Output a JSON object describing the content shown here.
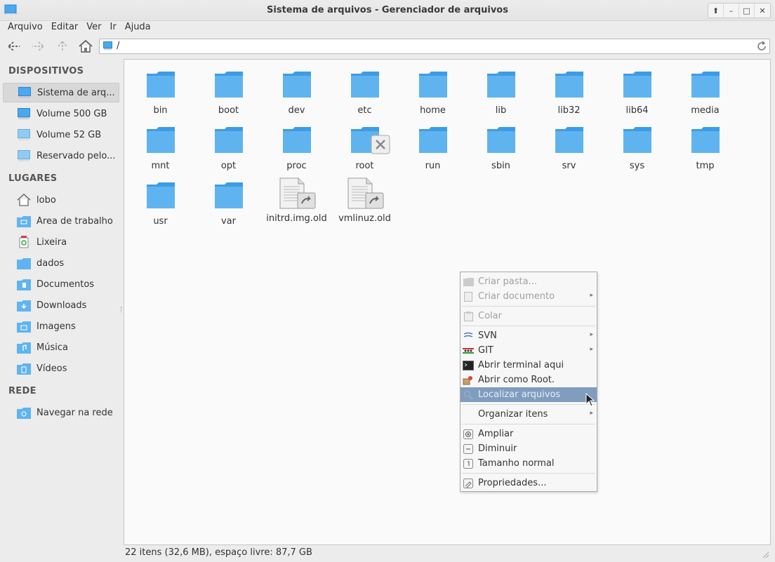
{
  "window": {
    "title": "Sistema de arquivos - Gerenciador de arquivos"
  },
  "menubar": [
    "Arquivo",
    "Editar",
    "Ver",
    "Ir",
    "Ajuda"
  ],
  "address": {
    "path": "/"
  },
  "sidebar": {
    "devices_header": "DISPOSITIVOS",
    "devices": [
      {
        "label": "Sistema de arq...",
        "icon": "drive-icon",
        "selected": true
      },
      {
        "label": "Volume 500 GB",
        "icon": "drive-icon",
        "selected": false
      },
      {
        "label": "Volume 52 GB",
        "icon": "drive-icon",
        "selected": false
      },
      {
        "label": "Reservado pelo...",
        "icon": "drive-icon",
        "selected": false
      }
    ],
    "places_header": "LUGARES",
    "places": [
      {
        "label": "lobo",
        "icon": "home-icon"
      },
      {
        "label": "Área de trabalho",
        "icon": "desktop-folder-icon"
      },
      {
        "label": "Lixeira",
        "icon": "trash-icon"
      },
      {
        "label": "dados",
        "icon": "folder-icon"
      },
      {
        "label": "Documentos",
        "icon": "documents-folder-icon"
      },
      {
        "label": "Downloads",
        "icon": "downloads-folder-icon"
      },
      {
        "label": "Imagens",
        "icon": "pictures-folder-icon"
      },
      {
        "label": "Música",
        "icon": "music-folder-icon"
      },
      {
        "label": "Vídeos",
        "icon": "videos-folder-icon"
      }
    ],
    "network_header": "REDE",
    "network": [
      {
        "label": "Navegar na rede",
        "icon": "network-folder-icon"
      }
    ]
  },
  "files": [
    {
      "name": "bin",
      "type": "folder"
    },
    {
      "name": "boot",
      "type": "folder"
    },
    {
      "name": "dev",
      "type": "folder"
    },
    {
      "name": "etc",
      "type": "folder"
    },
    {
      "name": "home",
      "type": "folder"
    },
    {
      "name": "lib",
      "type": "folder"
    },
    {
      "name": "lib32",
      "type": "folder"
    },
    {
      "name": "lib64",
      "type": "folder"
    },
    {
      "name": "media",
      "type": "folder"
    },
    {
      "name": "mnt",
      "type": "folder"
    },
    {
      "name": "opt",
      "type": "folder"
    },
    {
      "name": "proc",
      "type": "folder"
    },
    {
      "name": "root",
      "type": "folder-locked"
    },
    {
      "name": "run",
      "type": "folder"
    },
    {
      "name": "sbin",
      "type": "folder"
    },
    {
      "name": "srv",
      "type": "folder"
    },
    {
      "name": "sys",
      "type": "folder"
    },
    {
      "name": "tmp",
      "type": "folder"
    },
    {
      "name": "usr",
      "type": "folder"
    },
    {
      "name": "var",
      "type": "folder"
    },
    {
      "name": "initrd.img.old",
      "type": "symlink-file"
    },
    {
      "name": "vmlinuz.old",
      "type": "symlink-file"
    }
  ],
  "status": {
    "text": "22 itens (32,6 MB), espaço livre: 87,7 GB"
  },
  "context_menu": [
    {
      "label": "Criar pasta...",
      "icon": "new-folder-icon",
      "disabled": true
    },
    {
      "label": "Criar documento",
      "icon": "new-document-icon",
      "disabled": true,
      "submenu": true
    },
    {
      "separator": true
    },
    {
      "label": "Colar",
      "icon": "paste-icon",
      "disabled": true
    },
    {
      "separator": true
    },
    {
      "label": "SVN",
      "icon": "svn-icon",
      "submenu": true
    },
    {
      "label": "GIT",
      "icon": "git-icon",
      "submenu": true
    },
    {
      "label": "Abrir terminal aqui",
      "icon": "terminal-icon"
    },
    {
      "label": "Abrir como Root.",
      "icon": "root-icon"
    },
    {
      "label": "Localizar arquivos",
      "icon": "search-icon",
      "hover": true
    },
    {
      "separator": true
    },
    {
      "label": "Organizar itens",
      "icon": "",
      "submenu": true
    },
    {
      "separator": true
    },
    {
      "label": "Ampliar",
      "icon": "zoom-in-icon"
    },
    {
      "label": "Diminuir",
      "icon": "zoom-out-icon"
    },
    {
      "label": "Tamanho normal",
      "icon": "zoom-reset-icon"
    },
    {
      "separator": true
    },
    {
      "label": "Propriedades...",
      "icon": "properties-icon"
    }
  ],
  "colors": {
    "folder": "#5fb4f0",
    "folder_dark": "#3d9ce6",
    "hover": "#7f9dbf"
  }
}
